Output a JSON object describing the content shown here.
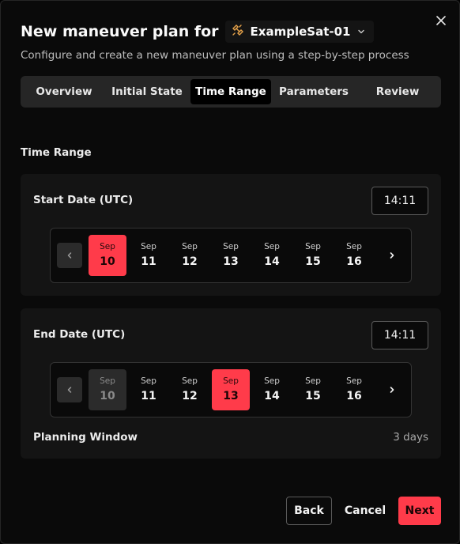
{
  "header": {
    "title": "New maneuver plan for",
    "satellite": "ExampleSat-01",
    "subtitle": "Configure and create a new maneuver plan using a step-by-step process"
  },
  "tabs": [
    {
      "label": "Overview",
      "active": false
    },
    {
      "label": "Initial State",
      "active": false
    },
    {
      "label": "Time Range",
      "active": true
    },
    {
      "label": "Parameters",
      "active": false
    },
    {
      "label": "Review",
      "active": false
    }
  ],
  "section_title": "Time Range",
  "start": {
    "label": "Start Date (UTC)",
    "time": "14:11",
    "days": [
      {
        "month": "Sep",
        "day": "10",
        "state": "selected"
      },
      {
        "month": "Sep",
        "day": "11",
        "state": ""
      },
      {
        "month": "Sep",
        "day": "12",
        "state": ""
      },
      {
        "month": "Sep",
        "day": "13",
        "state": ""
      },
      {
        "month": "Sep",
        "day": "14",
        "state": ""
      },
      {
        "month": "Sep",
        "day": "15",
        "state": ""
      },
      {
        "month": "Sep",
        "day": "16",
        "state": ""
      }
    ]
  },
  "end": {
    "label": "End Date (UTC)",
    "time": "14:11",
    "days": [
      {
        "month": "Sep",
        "day": "10",
        "state": "muted"
      },
      {
        "month": "Sep",
        "day": "11",
        "state": ""
      },
      {
        "month": "Sep",
        "day": "12",
        "state": ""
      },
      {
        "month": "Sep",
        "day": "13",
        "state": "selected"
      },
      {
        "month": "Sep",
        "day": "14",
        "state": ""
      },
      {
        "month": "Sep",
        "day": "15",
        "state": ""
      },
      {
        "month": "Sep",
        "day": "16",
        "state": ""
      }
    ]
  },
  "planning_window": {
    "label": "Planning Window",
    "value": "3 days"
  },
  "footer": {
    "back": "Back",
    "cancel": "Cancel",
    "next": "Next"
  },
  "colors": {
    "accent": "#ff3b4a",
    "background": "#0a0a0a",
    "card": "#141414"
  },
  "icons": {
    "close": "close-icon",
    "satellite": "satellite-icon",
    "dropdown": "chevron-down-icon",
    "prev": "chevron-left-icon",
    "next": "chevron-right-icon"
  }
}
